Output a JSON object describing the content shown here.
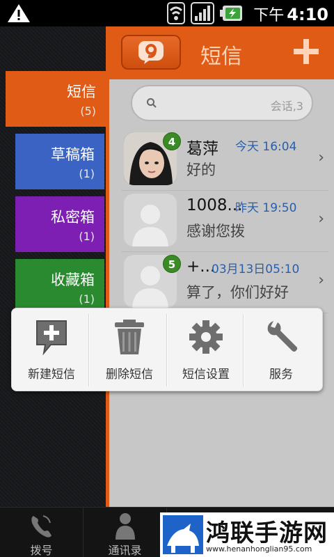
{
  "status_bar": {
    "ampm": "下午",
    "time": "4:10",
    "icons": [
      "warning-icon",
      "wifi-icon",
      "signal-icon",
      "battery-icon"
    ]
  },
  "folders": [
    {
      "name": "短信",
      "count": "(5)",
      "color": "#e05b16"
    },
    {
      "name": "草稿箱",
      "count": "(1)",
      "color": "#3a63c4"
    },
    {
      "name": "私密箱",
      "count": "(1)",
      "color": "#7c1fb2"
    },
    {
      "name": "收藏箱",
      "count": "(1)",
      "color": "#2a8a2f"
    }
  ],
  "header": {
    "title": "短信",
    "accent": "#e05b16"
  },
  "search": {
    "placeholder": "会话,3"
  },
  "conversations": [
    {
      "name": "葛萍",
      "time": "今天 16:04",
      "message": "好的",
      "badge": "4"
    },
    {
      "name": "1008...",
      "time": "昨天 19:50",
      "message": "感谢您拨",
      "badge": ""
    },
    {
      "name": "+...",
      "time": "03月13日05:10",
      "message": "算了，你们好好",
      "badge": "5"
    }
  ],
  "menu": {
    "items": [
      {
        "label": "新建短信",
        "icon": "new-message-icon"
      },
      {
        "label": "删除短信",
        "icon": "trash-icon"
      },
      {
        "label": "短信设置",
        "icon": "gear-icon"
      },
      {
        "label": "服务",
        "icon": "wrench-icon"
      }
    ]
  },
  "bottom_tabs": [
    {
      "label": "拨号",
      "icon": "phone-icon"
    },
    {
      "label": "通讯录",
      "icon": "contacts-icon"
    }
  ],
  "watermark": {
    "title": "鸿联手游网",
    "url": "www.henanhonglian95.com"
  }
}
